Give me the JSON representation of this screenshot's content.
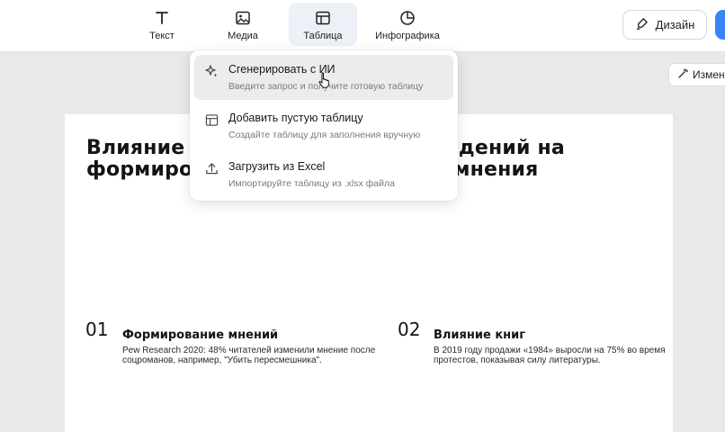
{
  "toolbar": {
    "tools": [
      {
        "label": "Текст",
        "icon": "text-icon"
      },
      {
        "label": "Медиа",
        "icon": "image-icon"
      },
      {
        "label": "Таблица",
        "icon": "table-icon",
        "active": true
      },
      {
        "label": "Инфографика",
        "icon": "pie-chart-icon"
      }
    ],
    "design_label": "Дизайн"
  },
  "edit_pill_label": "Измен",
  "menu": {
    "items": [
      {
        "title": "Сгенерировать с ИИ",
        "desc": "Введите запрос и получите готовую таблицу",
        "icon": "sparkle-icon",
        "hovered": true
      },
      {
        "title": "Добавить пустую таблицу",
        "desc": "Создайте таблицу для заполнения вручную",
        "icon": "table-icon"
      },
      {
        "title": "Загрузить из Excel",
        "desc": "Импортируйте таблицу из .xlsx файла",
        "icon": "upload-icon"
      }
    ]
  },
  "slide": {
    "title_line1": "Влияние литературных произведений на",
    "title_line2": "формирование общественного мнения",
    "points": [
      {
        "num": "01",
        "heading": "Формирование мнений",
        "body": "Pew Research 2020: 48% читателей изменили мнение после соцроманов, например, \"Убить пересмешника\"."
      },
      {
        "num": "02",
        "heading": "Влияние книг",
        "body": "В 2019 году продажи «1984» выросли на 75% во время протестов, показывая силу литературы."
      }
    ]
  },
  "colors": {
    "accent": "#3b82f6",
    "active_tab": "#eef0f8",
    "hover_row": "#ececee"
  }
}
